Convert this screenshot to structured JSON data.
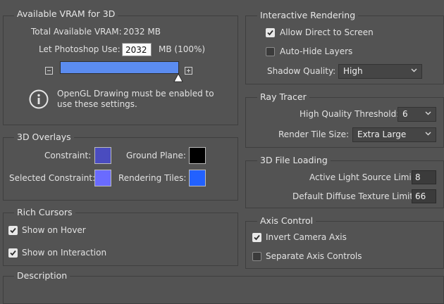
{
  "vram": {
    "title": "Available VRAM for 3D",
    "total_label": "Total Available VRAM:",
    "total_value": "2032 MB",
    "let_label": "Let Photoshop Use:",
    "let_value": "2032",
    "unit": "MB (100%)",
    "slider_fraction": 1.0,
    "info_text_1": "OpenGL Drawing must be enabled to",
    "info_text_2": "use these settings."
  },
  "overlays": {
    "title": "3D Overlays",
    "constraint_label": "Constraint:",
    "constraint_color": "#4a4cbf",
    "ground_label": "Ground Plane:",
    "ground_color": "#000000",
    "selected_label": "Selected Constraint:",
    "selected_color": "#6a6bff",
    "tiles_label": "Rendering Tiles:",
    "tiles_color": "#2261ff"
  },
  "cursors": {
    "title": "Rich Cursors",
    "hover_label": "Show on Hover",
    "hover_checked": true,
    "interaction_label": "Show on Interaction",
    "interaction_checked": true
  },
  "description": {
    "title": "Description"
  },
  "interactive": {
    "title": "Interactive Rendering",
    "direct_label": "Allow Direct to Screen",
    "direct_checked": true,
    "autohide_label": "Auto-Hide Layers",
    "autohide_checked": false,
    "shadow_label": "Shadow Quality:",
    "shadow_value": "High"
  },
  "raytracer": {
    "title": "Ray Tracer",
    "threshold_label": "High Quality Threshold:",
    "threshold_value": "6",
    "tile_label": "Render Tile Size:",
    "tile_value": "Extra Large"
  },
  "fileloading": {
    "title": "3D File Loading",
    "light_label": "Active Light Source Limit:",
    "light_value": "8",
    "diffuse_label": "Default Diffuse Texture Limit:",
    "diffuse_value": "66"
  },
  "axis": {
    "title": "Axis Control",
    "invert_label": "Invert Camera Axis",
    "invert_checked": true,
    "separate_label": "Separate Axis Controls",
    "separate_checked": false
  },
  "colors": {
    "panel_bg": "#535353",
    "border": "#3f3f3f",
    "slider_fill": "#5b8cf0"
  },
  "icons": [
    "minus-icon",
    "plus-icon",
    "info-icon",
    "checkmark-icon",
    "chevron-down-icon"
  ]
}
